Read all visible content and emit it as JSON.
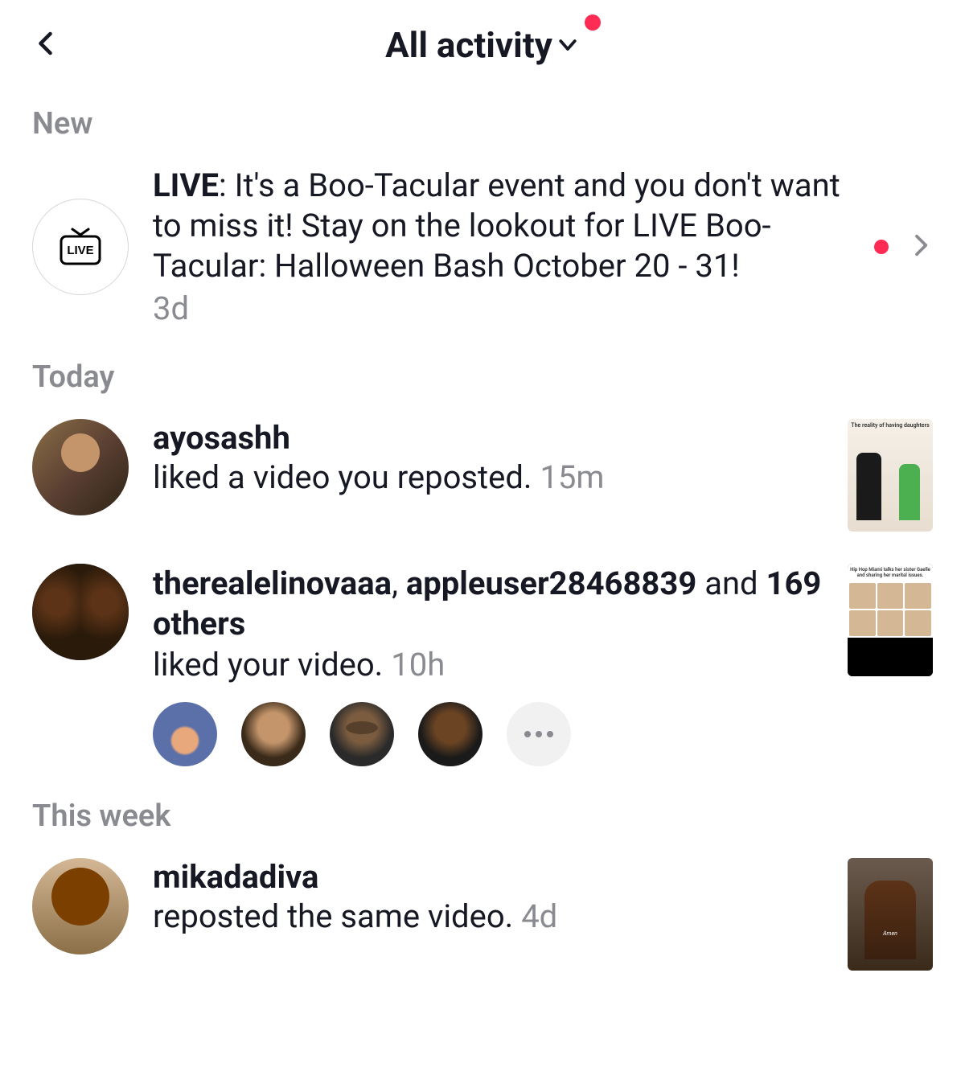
{
  "header": {
    "title": "All activity"
  },
  "sections": {
    "new": "New",
    "today": "Today",
    "thisWeek": "This week"
  },
  "live": {
    "prefix": "LIVE",
    "message": ": It's a Boo-Tacular event and you don't want to miss it! Stay on the lookout for LIVE Boo-Tacular: Halloween Bash October 20 - 31!",
    "time": "3d"
  },
  "today": {
    "item1": {
      "username": "ayosashh",
      "action": "liked a video you reposted.",
      "time": "15m",
      "thumbCaption": "The reality of having daughters"
    },
    "item2": {
      "user1": "therealelinovaaa",
      "sep": ", ",
      "user2": "appleuser28468839",
      "and": " and ",
      "others": "169 others",
      "action": "liked your video.",
      "time": "10h",
      "thumbCaption": "Hip Hop Miami talks her sister Gaelle and sharing her marital issues."
    }
  },
  "thisWeek": {
    "item1": {
      "username": "mikadadiva",
      "action": "reposted the same video.",
      "time": "4d",
      "thumbCaption": "Amen"
    }
  }
}
